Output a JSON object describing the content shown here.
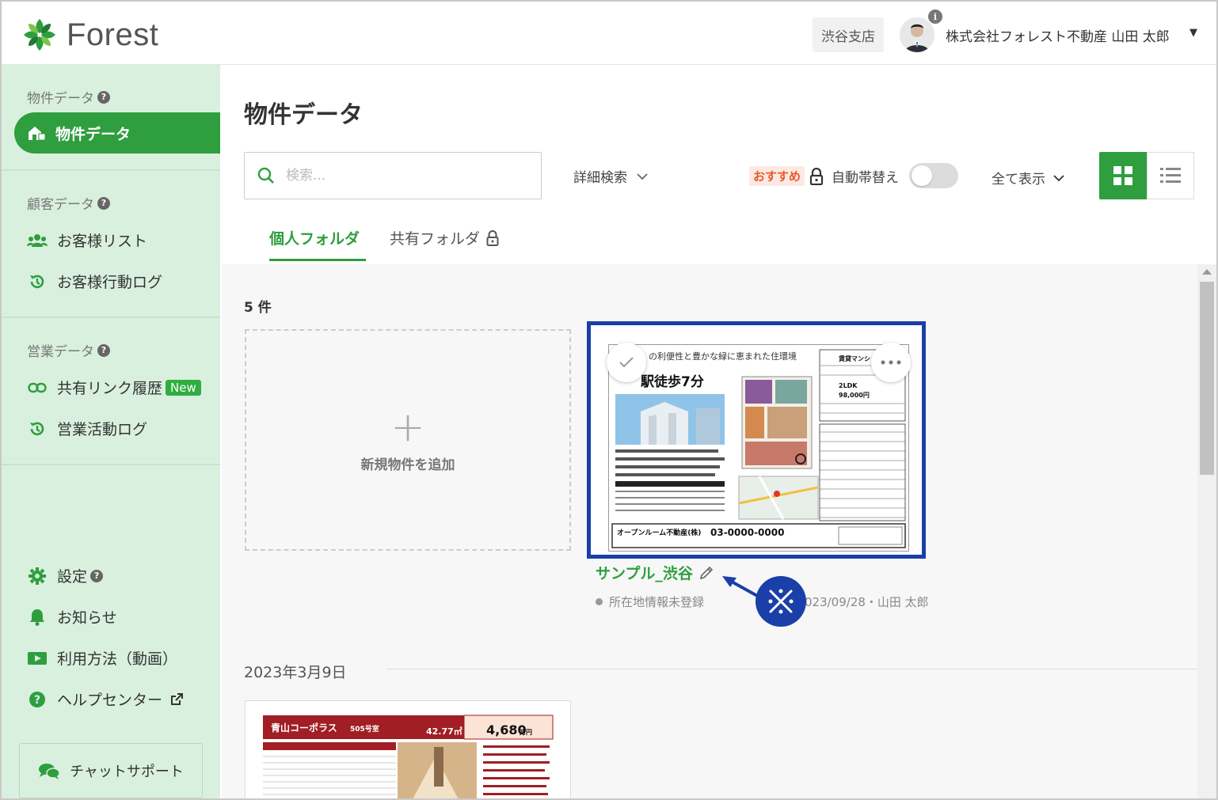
{
  "header": {
    "logo_text": "Forest",
    "branch": "渋谷支店",
    "user_name": "株式会社フォレスト不動産 山田 太郎",
    "info_glyph": "i",
    "caret": "▼"
  },
  "sidebar": {
    "section_property": "物件データ",
    "active_item": "物件データ",
    "section_customer": "顧客データ",
    "item_customer_list": "お客様リスト",
    "item_customer_log": "お客様行動ログ",
    "section_sales": "営業データ",
    "item_share_history": "共有リンク履歴",
    "badge_new": "New",
    "item_sales_log": "営業活動ログ",
    "item_settings": "設定",
    "item_notice": "お知らせ",
    "item_howto": "利用方法（動画）",
    "item_help": "ヘルプセンター",
    "chat": "チャットサポート",
    "qmark": "?"
  },
  "main": {
    "title": "物件データ",
    "search_placeholder": "検索...",
    "advanced_search": "詳細検索",
    "recommend": "おすすめ",
    "auto_label": "自動帯替え",
    "auto_on": false,
    "show_all": "全て表示",
    "tab_personal": "個人フォルダ",
    "tab_shared": "共有フォルダ",
    "count": "5 件",
    "add_label": "新規物件を追加",
    "add_plus": "+",
    "property_name": "サンプル_渋谷",
    "property_meta": "所在地情報未登録",
    "property_date": "023/09/28・山田 太郎",
    "date_group": "2023年3月9日"
  },
  "flyer1": {
    "headline": "の利便性と豊かな緑に恵まれた住環境",
    "walk": "駅徒歩7分",
    "building": "賃貸マンション",
    "layout": "2LDK",
    "rent": "98,000円",
    "company": "オープンルーム不動産(株)",
    "phone": "03-0000-0000"
  },
  "flyer2": {
    "name": "青山コーポラス",
    "room": "505号室",
    "area": "42.77㎡",
    "price": "4,680",
    "price_unit": "万円"
  },
  "colors": {
    "brand_green": "#2e9e3e",
    "sidebar_bg": "#d9f0de",
    "highlight_blue": "#1a3fa8",
    "recommend_text": "#e85a2a"
  }
}
